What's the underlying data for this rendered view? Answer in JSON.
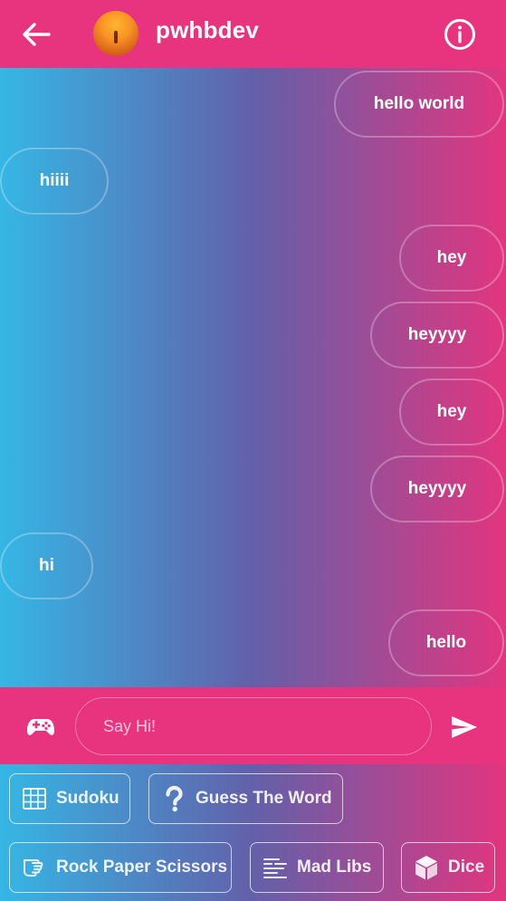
{
  "header": {
    "username": "pwhbdev",
    "back_icon": "arrow-left-icon",
    "info_icon": "info-circle-icon",
    "avatar": "sunset-avatar"
  },
  "messages": [
    {
      "text": "hello world",
      "side": "sent"
    },
    {
      "text": "hiiii",
      "side": "received"
    },
    {
      "text": "hey",
      "side": "sent"
    },
    {
      "text": "heyyyy",
      "side": "sent"
    },
    {
      "text": "hey",
      "side": "sent"
    },
    {
      "text": "heyyyy",
      "side": "sent"
    },
    {
      "text": "hi",
      "side": "received"
    },
    {
      "text": "hello",
      "side": "sent"
    }
  ],
  "composer": {
    "placeholder": "Say Hi!",
    "value": "",
    "games_icon": "gamepad-icon",
    "send_icon": "send-icon"
  },
  "games": [
    {
      "label": "Sudoku",
      "icon": "grid-icon"
    },
    {
      "label": "Guess The Word",
      "icon": "question-icon"
    },
    {
      "label": "Rock Paper Scissors",
      "icon": "hand-icon"
    },
    {
      "label": "Mad Libs",
      "icon": "text-lines-icon"
    },
    {
      "label": "Dice",
      "icon": "dice-icon"
    }
  ],
  "colors": {
    "accent": "#e8337f",
    "gradient_start": "#35b6e4",
    "gradient_mid": "#6360aa",
    "gradient_end": "#e2357f",
    "text": "#ffffff"
  }
}
